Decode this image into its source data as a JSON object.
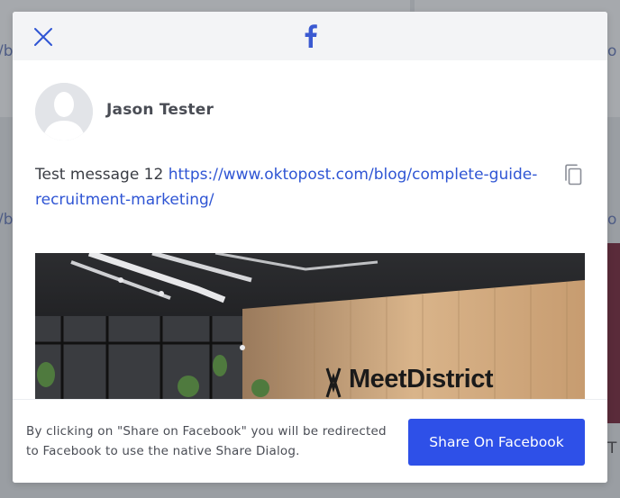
{
  "modal": {
    "close_icon": "close-icon",
    "brand_icon": "facebook-logo-icon",
    "user": {
      "name": "Jason Tester",
      "avatar_icon": "avatar-placeholder-icon"
    },
    "message": {
      "text": "Test message 12 ",
      "link": "https://www.oktopost.com/blog/complete-guide-recruitment-marketing/"
    },
    "copy_icon": "copy-icon",
    "preview": {
      "brand_text": "MeetDistrict"
    },
    "footer": {
      "notice": "By clicking on \"Share on Facebook\" you will be redirected to Facebook to use the native Share Dialog.",
      "share_button_label": "Share On Facebook"
    }
  },
  "colors": {
    "accent": "#2e50e8",
    "link": "#2f55d4",
    "header_bg": "#f3f4f6"
  }
}
